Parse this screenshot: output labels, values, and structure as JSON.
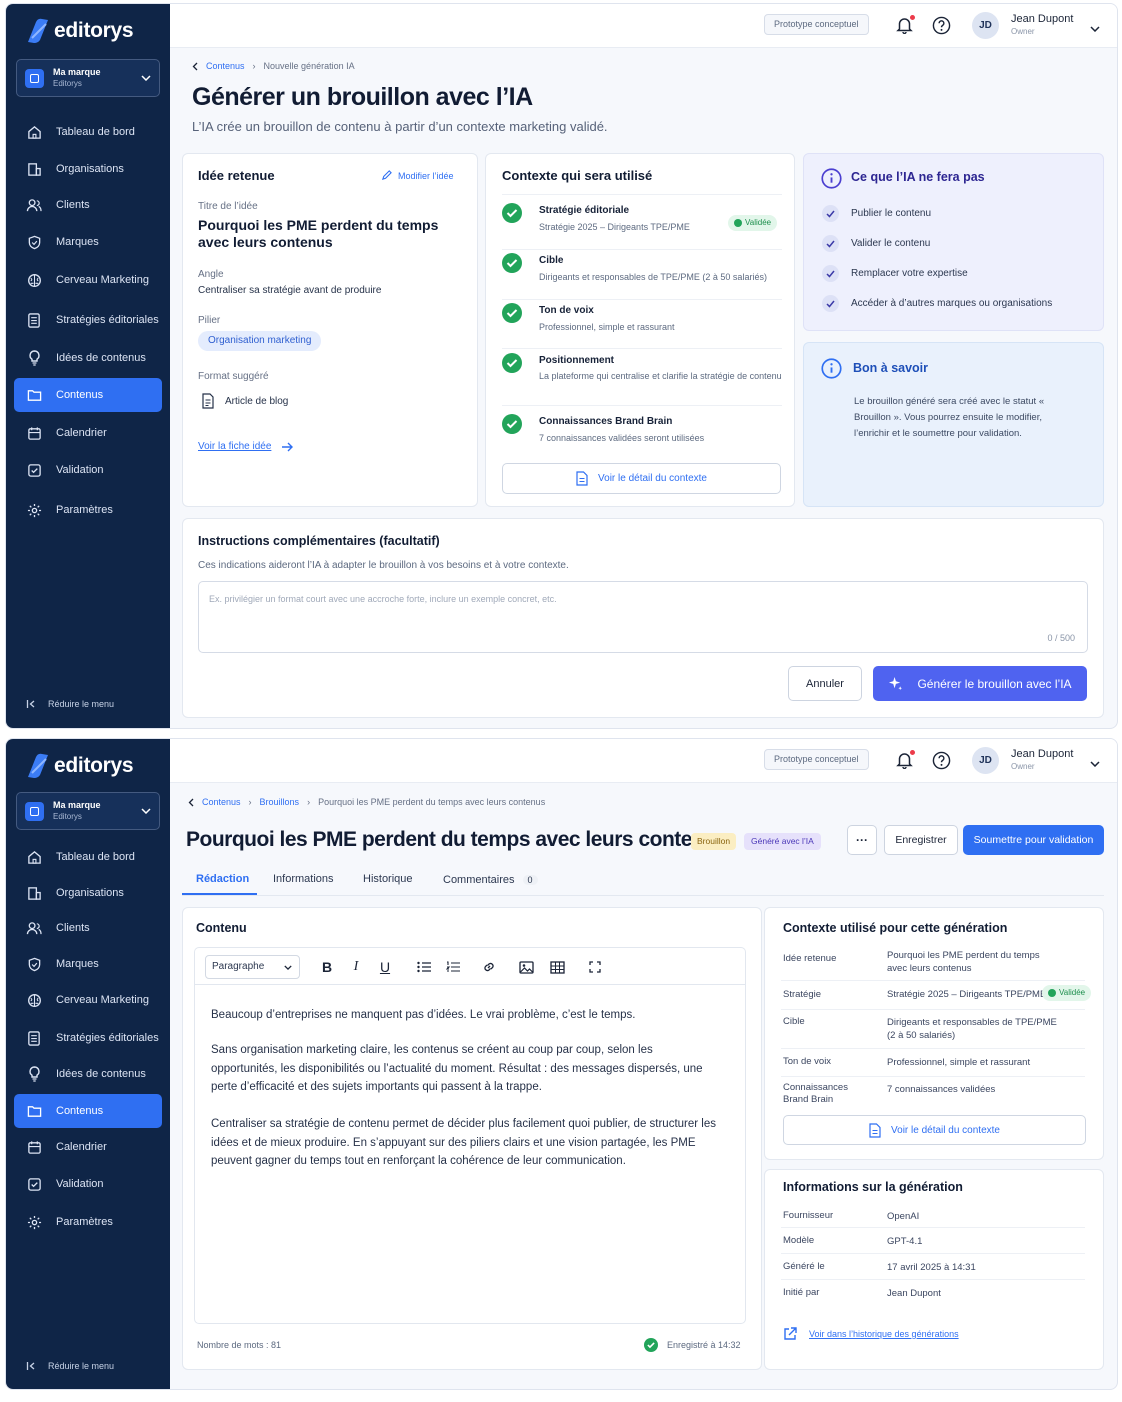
{
  "app": {
    "logo": "editorys"
  },
  "brand_selector": {
    "name": "Ma marque",
    "org": "Editorys"
  },
  "sidebar": {
    "items": [
      {
        "label": "Tableau de bord",
        "icon": "home-icon"
      },
      {
        "label": "Organisations",
        "icon": "building-icon"
      },
      {
        "label": "Clients",
        "icon": "users-icon"
      },
      {
        "label": "Marques",
        "icon": "shield-icon"
      },
      {
        "label": "Cerveau Marketing",
        "icon": "brain-icon"
      },
      {
        "label": "Stratégies éditoriales",
        "icon": "document-list-icon"
      },
      {
        "label": "Idées de contenus",
        "icon": "lightbulb-icon"
      },
      {
        "label": "Contenus",
        "icon": "folder-icon"
      },
      {
        "label": "Calendrier",
        "icon": "calendar-icon"
      },
      {
        "label": "Validation",
        "icon": "checkbox-icon"
      },
      {
        "label": "Paramètres",
        "icon": "gear-icon"
      }
    ],
    "active": "Contenus",
    "collapse_label": "Réduire le menu"
  },
  "topbar": {
    "proto_label": "Prototype conceptuel",
    "user_initials": "JD",
    "user_name": "Jean Dupont",
    "user_role": "Owner"
  },
  "screen1": {
    "breadcrumb": [
      "Contenus",
      "Nouvelle génération IA"
    ],
    "title": "Générer un brouillon avec l’IA",
    "subtitle": "L’IA crée un brouillon de contenu à partir d’un contexte marketing validé.",
    "idea_card": {
      "title": "Idée retenue",
      "edit_label": "Modifier l’idée",
      "title_label": "Titre de l’idée",
      "idea_title": "Pourquoi les PME perdent du temps avec leurs contenus",
      "angle_label": "Angle",
      "angle_value": "Centraliser sa stratégie avant de produire",
      "pillar_label": "Pilier",
      "pillar_value": "Organisation marketing",
      "format_label": "Format suggéré",
      "format_value": "Article de blog",
      "link": "Voir la fiche idée"
    },
    "context_card": {
      "title": "Contexte qui sera utilisé",
      "rows": [
        {
          "title": "Stratégie éditoriale",
          "sub": "Stratégie 2025 – Dirigeants TPE/PME",
          "badge": "Validée"
        },
        {
          "title": "Cible",
          "sub": "Dirigeants et responsables de TPE/PME (2 à 50 salariés)"
        },
        {
          "title": "Ton de voix",
          "sub": "Professionnel, simple et rassurant"
        },
        {
          "title": "Positionnement",
          "sub": "La plateforme qui centralise et clarifie la stratégie de contenu"
        },
        {
          "title": "Connaissances Brand Brain",
          "sub": "7 connaissances validées seront utilisées"
        }
      ],
      "button": "Voir le détail du contexte"
    },
    "limits_card": {
      "title": "Ce que l’IA ne fera pas",
      "items": [
        "Publier le contenu",
        "Valider le contenu",
        "Remplacer votre expertise",
        "Accéder à d’autres marques ou organisations"
      ]
    },
    "info_card": {
      "title": "Bon à savoir",
      "text": "Le brouillon généré sera créé avec le statut « Brouillon ». Vous pourrez ensuite le modifier, l’enrichir et le soumettre pour validation."
    },
    "instructions": {
      "title": "Instructions complémentaires (facultatif)",
      "help": "Ces indications aideront l’IA à adapter le brouillon à vos besoins et à votre contexte.",
      "placeholder": "Ex. privilégier un format court avec une accroche forte, inclure un exemple concret, etc.",
      "counter": "0 / 500"
    },
    "cancel_label": "Annuler",
    "generate_label": "Générer le brouillon avec l’IA"
  },
  "screen2": {
    "breadcrumb": [
      "Contenus",
      "Brouillons",
      "Pourquoi les PME perdent du temps avec leurs contenus"
    ],
    "title": "Pourquoi les PME perdent du temps avec leurs contenus",
    "badge_draft": "Brouillon",
    "badge_ai": "Généré avec l’IA",
    "more_label": "···",
    "save_label": "Enregistrer",
    "submit_label": "Soumettre pour validation",
    "tabs": [
      {
        "label": "Rédaction"
      },
      {
        "label": "Informations"
      },
      {
        "label": "Historique"
      },
      {
        "label": "Commentaires",
        "count": "0"
      }
    ],
    "editor": {
      "title": "Contenu",
      "paragraph_style": "Paragraphe",
      "paragraphs": [
        "Beaucoup d’entreprises ne manquent pas d’idées. Le vrai problème, c’est le temps.",
        "Sans organisation marketing claire, les contenus se créent au coup par coup, selon les opportunités, les disponibilités ou l’actualité du moment. Résultat : des messages dispersés, une perte d’efficacité et des sujets importants qui passent à la trappe.",
        "Centraliser sa stratégie de contenu permet de décider plus facilement quoi publier, de structurer les idées et de mieux produire. En s’appuyant sur des piliers clairs et une vision partagée, les PME peuvent gagner du temps tout en renforçant la cohérence de leur communication."
      ],
      "word_count": "Nombre de mots : 81",
      "saved": "Enregistré à 14:32"
    },
    "context": {
      "title": "Contexte utilisé pour cette génération",
      "rows": [
        {
          "k": "Idée retenue",
          "v": "Pourquoi les PME perdent du temps avec leurs contenus"
        },
        {
          "k": "Stratégie",
          "v": "Stratégie 2025 – Dirigeants TPE/PME",
          "badge": "Validée"
        },
        {
          "k": "Cible",
          "v": "Dirigeants et responsables de TPE/PME (2 à 50 salariés)"
        },
        {
          "k": "Ton de voix",
          "v": "Professionnel, simple et rassurant"
        },
        {
          "k": "Connaissances Brand Brain",
          "v": "7 connaissances validées"
        }
      ],
      "button": "Voir le détail du contexte"
    },
    "generation": {
      "title": "Informations sur la génération",
      "rows": [
        {
          "k": "Fournisseur",
          "v": "OpenAI"
        },
        {
          "k": "Modèle",
          "v": "GPT-4.1"
        },
        {
          "k": "Généré le",
          "v": "17 avril 2025 à 14:31"
        },
        {
          "k": "Initié par",
          "v": "Jean Dupont"
        }
      ],
      "link": "Voir dans l’historique des générations"
    }
  },
  "colors": {
    "sidebar": "#0f2547",
    "accent": "#2f6ff2",
    "primary_button": "#4f63f0",
    "success": "#22a45a"
  }
}
